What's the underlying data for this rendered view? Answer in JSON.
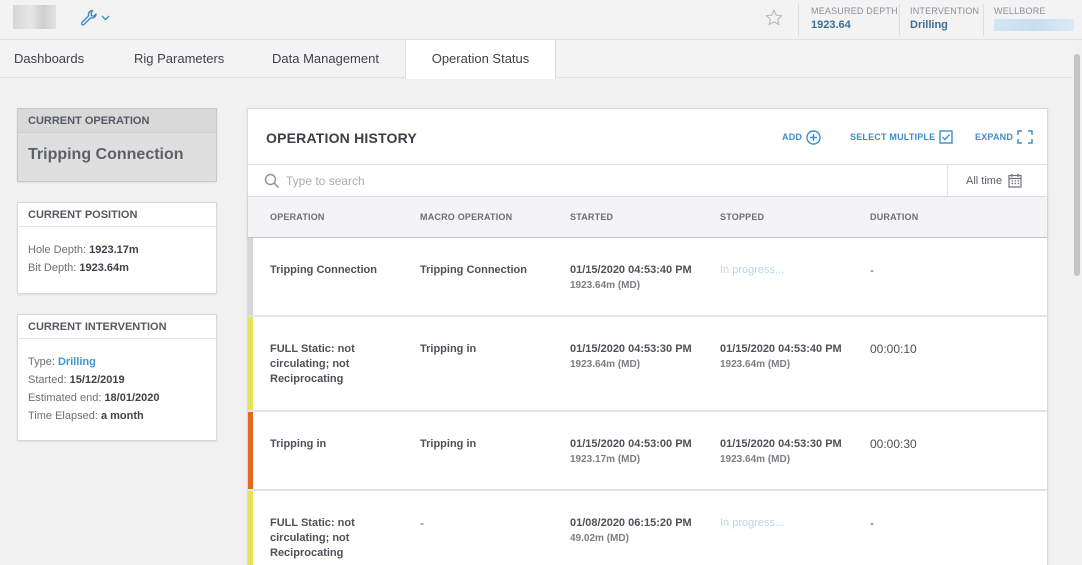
{
  "header": {
    "measured_depth_label": "MEASURED DEPTH",
    "measured_depth_value": "1923.64",
    "intervention_label": "INTERVENTION",
    "intervention_value": "Drilling",
    "wellbore_label": "WELLBORE",
    "accent": "#3a8fc9"
  },
  "tabs": [
    {
      "label": "Dashboards",
      "active": false
    },
    {
      "label": "Rig Parameters",
      "active": false
    },
    {
      "label": "Data Management",
      "active": false
    },
    {
      "label": "Operation Status",
      "active": true
    }
  ],
  "current_operation": {
    "title": "CURRENT OPERATION",
    "value": "Tripping Connection"
  },
  "current_position": {
    "title": "CURRENT POSITION",
    "hole_depth_label": "Hole Depth:",
    "hole_depth_value": "1923.17m",
    "bit_depth_label": "Bit Depth:",
    "bit_depth_value": "1923.64m"
  },
  "current_intervention": {
    "title": "CURRENT INTERVENTION",
    "type_label": "Type:",
    "type_value": "Drilling",
    "started_label": "Started:",
    "started_value": "15/12/2019",
    "estimated_end_label": "Estimated end:",
    "estimated_end_value": "18/01/2020",
    "time_elapsed_label": "Time Elapsed:",
    "time_elapsed_value": "a month"
  },
  "history": {
    "title": "OPERATION HISTORY",
    "add_label": "ADD",
    "select_multiple_label": "SELECT MULTIPLE",
    "expand_label": "EXPAND",
    "search_placeholder": "Type to search",
    "time_filter": "All time",
    "columns": [
      "OPERATION",
      "MACRO OPERATION",
      "STARTED",
      "STOPPED",
      "DURATION"
    ],
    "rows": [
      {
        "operation": "Tripping Connection",
        "macro": "Tripping Connection",
        "started": "01/15/2020 04:53:40 PM",
        "started_md": "1923.64m (MD)",
        "stopped": "In progress...",
        "stopped_md": "",
        "duration": "-",
        "color": "#d6d6d6"
      },
      {
        "operation": "FULL Static: not circulating; not Reciprocating",
        "macro": "Tripping in",
        "started": "01/15/2020 04:53:30 PM",
        "started_md": "1923.64m (MD)",
        "stopped": "01/15/2020 04:53:40 PM",
        "stopped_md": "1923.64m (MD)",
        "duration": "00:00:10",
        "color": "#e7e35a"
      },
      {
        "operation": "Tripping in",
        "macro": "Tripping in",
        "started": "01/15/2020 04:53:00 PM",
        "started_md": "1923.17m (MD)",
        "stopped": "01/15/2020 04:53:30 PM",
        "stopped_md": "1923.64m (MD)",
        "duration": "00:00:30",
        "color": "#e06a1f"
      },
      {
        "operation": "FULL Static: not circulating; not Reciprocating",
        "macro": "-",
        "started": "01/08/2020 06:15:20 PM",
        "started_md": "49.02m (MD)",
        "stopped": "In progress...",
        "stopped_md": "",
        "duration": "-",
        "color": "#e7e35a"
      }
    ]
  }
}
